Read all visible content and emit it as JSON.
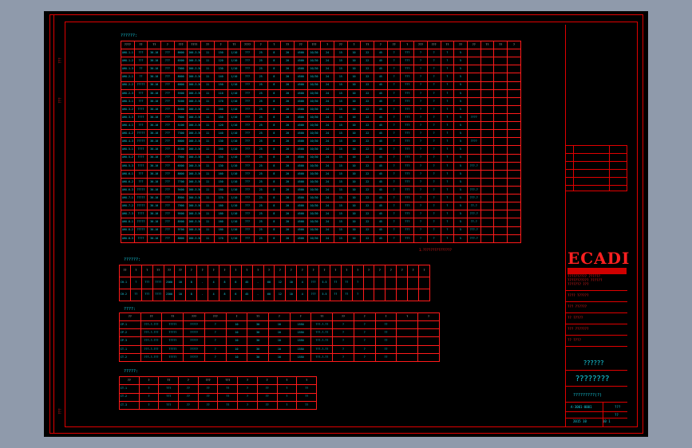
{
  "drawing": {
    "main_title": "??????:",
    "note_text": "1.???????????????",
    "section2_title": "??????:",
    "section3_title": "????:",
    "section4_title": "?????:",
    "logo": "ECADI",
    "logo_sub1": "?????????? ??????",
    "logo_sub2": "??????????? ??????",
    "logo_sub3": "??????? ???",
    "tb_field1": "???? ??????",
    "tb_field2": "??? ??????",
    "tb_field3": "?? ?????",
    "tb_field4": "??? ???????",
    "tb_field5": "?? ????",
    "tb_project": "??????",
    "tb_drawing": "????????",
    "tb_drawing_no": "?????????(?)",
    "tb_no": "A-3001-0001",
    "tb_rev1": "???",
    "tb_rev2": "??",
    "tb_date": "2015 10",
    "tb_sheet": "10 1",
    "side_label1": "???",
    "side_label2": "???",
    "side_label3": "???"
  },
  "table1": {
    "headers": [
      "????",
      "??",
      "??",
      "?",
      "???",
      "????",
      "??",
      "?",
      "??",
      "????",
      "?",
      "?",
      "??",
      "??",
      "???",
      "?",
      "??",
      "?",
      "??",
      "?",
      "??",
      "?",
      "???",
      "???",
      "??",
      "??",
      "??",
      "??",
      "??",
      "?"
    ],
    "rows": [
      [
        "AHU-1-1",
        "???",
        "30-10",
        "???",
        "8600",
        "200-3-50",
        "11",
        "150",
        "1/10",
        "???",
        "25",
        "8",
        "20",
        "4500",
        "10/30",
        "24",
        "15",
        "10",
        "22",
        "45",
        "?",
        "???",
        "?",
        "?",
        "?",
        "5",
        ""
      ],
      [
        "AHU-1-2",
        "???",
        "30-10",
        "???",
        "6500",
        "200-3-50",
        "11",
        "120",
        "1/10",
        "???",
        "25",
        "8",
        "20",
        "4500",
        "10/30",
        "24",
        "15",
        "10",
        "22",
        "45",
        "?",
        "???",
        "?",
        "?",
        "?",
        "5",
        ""
      ],
      [
        "AHU-1-3",
        "??",
        "30-10",
        "???",
        "7000",
        "200-3-50",
        "11",
        "130",
        "1/10",
        "???",
        "25",
        "8",
        "20",
        "4500",
        "10/30",
        "24",
        "15",
        "10",
        "22",
        "45",
        "?",
        "???",
        "?",
        "?",
        "?",
        "5",
        ""
      ],
      [
        "AHU-2-1",
        "??",
        "30-10",
        "???",
        "8000",
        "200-3-50",
        "11",
        "140",
        "1/10",
        "???",
        "25",
        "8",
        "20",
        "4500",
        "10/30",
        "24",
        "15",
        "10",
        "22",
        "45",
        "?",
        "???",
        "?",
        "?",
        "?",
        "5",
        ""
      ],
      [
        "AHU-2-2",
        "?????",
        "30-10",
        "???",
        "6800",
        "200-3-50",
        "11",
        "150",
        "1/10",
        "???",
        "25",
        "8",
        "20",
        "4500",
        "10/30",
        "24",
        "15",
        "10",
        "22",
        "45",
        "?",
        "???",
        "?",
        "?",
        "?",
        "5",
        ""
      ],
      [
        "AHU-2-3",
        "???",
        "30-10",
        "???",
        "5500",
        "200-3-50",
        "11",
        "110",
        "1/10",
        "???",
        "25",
        "8",
        "20",
        "4500",
        "10/30",
        "24",
        "15",
        "10",
        "22",
        "45",
        "?",
        "???",
        "?",
        "?",
        "?",
        "5",
        ""
      ],
      [
        "AHU-3-1",
        "???",
        "30-10",
        "???",
        "9200",
        "200-3-50",
        "11",
        "170",
        "1/10",
        "???",
        "25",
        "8",
        "20",
        "4500",
        "10/30",
        "24",
        "15",
        "10",
        "22",
        "45",
        "?",
        "???",
        "?",
        "?",
        "?",
        "5",
        ""
      ],
      [
        "AHU-3-2",
        "????",
        "30-10",
        "???",
        "8400",
        "200-3-50",
        "11",
        "160",
        "1/10",
        "???",
        "25",
        "8",
        "20",
        "4500",
        "10/30",
        "24",
        "15",
        "10",
        "22",
        "45",
        "?",
        "???",
        "?",
        "?",
        "?",
        "5",
        ""
      ],
      [
        "AHU-3-3",
        "????",
        "30-10",
        "???",
        "7600",
        "200-3-50",
        "11",
        "150",
        "1/10",
        "???",
        "25",
        "8",
        "20",
        "4500",
        "10/30",
        "24",
        "15",
        "10",
        "22",
        "45",
        "?",
        "???",
        "?",
        "?",
        "?",
        "5",
        "????"
      ],
      [
        "AHU-4-1",
        "???",
        "30-10",
        "???",
        "5100",
        "200-3-50",
        "11",
        "120",
        "1/10",
        "???",
        "25",
        "8",
        "20",
        "4500",
        "10/30",
        "24",
        "15",
        "10",
        "22",
        "45",
        "?",
        "???",
        "?",
        "?",
        "?",
        "5",
        ""
      ],
      [
        "AHU-4-2",
        "?????",
        "30-10",
        "???",
        "7300",
        "200-3-50",
        "11",
        "140",
        "1/10",
        "???",
        "25",
        "8",
        "20",
        "4500",
        "10/30",
        "24",
        "15",
        "10",
        "22",
        "45",
        "?",
        "???",
        "?",
        "?",
        "?",
        "5",
        ""
      ],
      [
        "AHU-4-3",
        "?????",
        "30-10",
        "???",
        "6800",
        "200-3-50",
        "11",
        "130",
        "1/10",
        "???",
        "25",
        "8",
        "20",
        "4500",
        "10/30",
        "24",
        "15",
        "10",
        "22",
        "45",
        "?",
        "???",
        "?",
        "?",
        "?",
        "5",
        "????"
      ],
      [
        "AHU-5-1",
        "????",
        "30-10",
        "???",
        "8100",
        "200-3-50",
        "11",
        "160",
        "1/10",
        "???",
        "25",
        "8",
        "20",
        "4500",
        "10/30",
        "24",
        "15",
        "10",
        "22",
        "45",
        "?",
        "???",
        "?",
        "?",
        "?",
        "5",
        ""
      ],
      [
        "AHU-5-2",
        "????",
        "30-10",
        "???",
        "7900",
        "200-3-50",
        "11",
        "150",
        "1/10",
        "???",
        "25",
        "8",
        "20",
        "4500",
        "10/30",
        "24",
        "15",
        "10",
        "22",
        "45",
        "?",
        "???",
        "?",
        "?",
        "?",
        "5",
        ""
      ],
      [
        "AHU-5-3",
        "????",
        "30-10",
        "???",
        "6500",
        "200-3-50",
        "11",
        "130",
        "1/10",
        "???",
        "25",
        "8",
        "20",
        "4500",
        "10/30",
        "24",
        "15",
        "10",
        "22",
        "45",
        "?",
        "???",
        "?",
        "?",
        "?",
        "5",
        "???-?"
      ],
      [
        "AHU-6-1",
        "???",
        "30-10",
        "???",
        "8800",
        "200-3-50",
        "11",
        "160",
        "1/10",
        "???",
        "25",
        "8",
        "20",
        "4500",
        "10/30",
        "24",
        "15",
        "10",
        "22",
        "45",
        "?",
        "???",
        "?",
        "?",
        "?",
        "5",
        ""
      ],
      [
        "AHU-6-2",
        "???",
        "30-10",
        "???",
        "7700",
        "200-3-50",
        "11",
        "150",
        "1/10",
        "???",
        "25",
        "8",
        "20",
        "4500",
        "10/30",
        "24",
        "15",
        "10",
        "22",
        "45",
        "?",
        "???",
        "?",
        "?",
        "?",
        "5",
        ""
      ],
      [
        "AHU-6-3",
        "?????",
        "30-10",
        "???",
        "9400",
        "200-3-50",
        "11",
        "180",
        "1/10",
        "???",
        "25",
        "8",
        "20",
        "4500",
        "10/30",
        "24",
        "15",
        "10",
        "22",
        "45",
        "?",
        "???",
        "?",
        "?",
        "?",
        "5",
        "???-?"
      ],
      [
        "AHU-7-1",
        "?????",
        "30-10",
        "???",
        "8900",
        "200-3-50",
        "11",
        "170",
        "1/10",
        "???",
        "25",
        "8",
        "20",
        "4500",
        "10/30",
        "24",
        "15",
        "10",
        "22",
        "45",
        "?",
        "???",
        "?",
        "?",
        "?",
        "5",
        "???-?"
      ],
      [
        "AHU-7-2",
        "?????",
        "30-10",
        "???",
        "7900",
        "200-3-50",
        "11",
        "160",
        "1/10",
        "???",
        "25",
        "8",
        "20",
        "4500",
        "10/30",
        "24",
        "15",
        "10",
        "22",
        "45",
        "?",
        "???",
        "?",
        "?",
        "?",
        "5",
        "??-?"
      ],
      [
        "AHU-7-3",
        "????",
        "30-10",
        "???",
        "9500",
        "200-3-50",
        "11",
        "180",
        "1/10",
        "???",
        "25",
        "8",
        "20",
        "4500",
        "10/30",
        "24",
        "15",
        "10",
        "22",
        "45",
        "?",
        "???",
        "?",
        "?",
        "?",
        "5",
        "???-?"
      ],
      [
        "AHU-8-1",
        "?????",
        "30-10",
        "???",
        "8500",
        "200-3-50",
        "11",
        "160",
        "1/10",
        "???",
        "25",
        "8",
        "20",
        "4500",
        "10/30",
        "24",
        "15",
        "10",
        "22",
        "45",
        "?",
        "???",
        "?",
        "?",
        "?",
        "5",
        "??-?"
      ],
      [
        "AHU-8-2",
        "?????",
        "30-10",
        "???",
        "9700",
        "200-3-50",
        "11",
        "180",
        "1/10",
        "???",
        "25",
        "8",
        "20",
        "4500",
        "10/30",
        "24",
        "15",
        "10",
        "22",
        "45",
        "?",
        "???",
        "?",
        "?",
        "?",
        "5",
        "???-?"
      ],
      [
        "AHU-8-3",
        "????",
        "30-10",
        "???",
        "8800",
        "200-3-50",
        "11",
        "170",
        "1/10",
        "???",
        "25",
        "8",
        "20",
        "4500",
        "10/30",
        "24",
        "15",
        "10",
        "22",
        "45",
        "?",
        "???",
        "?",
        "?",
        "?",
        "5",
        "???-?"
      ]
    ]
  },
  "table2": {
    "headers": [
      "??",
      "?",
      "?",
      "??",
      "??",
      "??",
      "?",
      "?",
      "?",
      "?",
      "?",
      "?",
      "?",
      "?",
      "?",
      "?",
      "?",
      "?",
      "?",
      "?",
      "?",
      "?",
      "?",
      "?",
      "?",
      "?",
      "?",
      "?"
    ],
    "rows": [
      [
        "CH-1",
        "?",
        "???",
        "????",
        "2560",
        "10",
        "8",
        "-",
        "4",
        "8",
        "6",
        "45",
        "-",
        "60",
        "12",
        "10",
        "4",
        "???",
        "5.5",
        "??",
        "??",
        "?"
      ],
      [
        "CH-2",
        "??",
        "???",
        "????",
        "2300",
        "10",
        "8",
        "-",
        "4",
        "8",
        "6",
        "45",
        "-",
        "60",
        "12",
        "10",
        "4",
        "???",
        "5.5",
        "??",
        "??",
        "?"
      ]
    ]
  },
  "table3": {
    "headers": [
      "??",
      "??",
      "??",
      "???",
      "???",
      "?",
      "??",
      "?",
      "?",
      "??",
      "??",
      "?",
      "?",
      "?",
      "?"
    ],
    "rows": [
      [
        "CP-1",
        "???-?-???",
        "?????",
        "?????",
        "?",
        "10",
        "30",
        "10",
        "1550",
        "???-?-??",
        "?",
        "?",
        "??"
      ],
      [
        "CP-2",
        "???-?-???",
        "?????",
        "?????",
        "?",
        "10",
        "30",
        "10",
        "1550",
        "???-?-??",
        "?",
        "?",
        "??"
      ],
      [
        "CP-3",
        "???-?-???",
        "?????",
        "?????",
        "?",
        "10",
        "30",
        "10",
        "1550",
        "???-?-??",
        "?",
        "?",
        "??"
      ],
      [
        "CT-1",
        "???-?-???",
        "?????",
        "?????",
        "?",
        "10",
        "30",
        "10",
        "1550",
        "???-?-??",
        "?",
        "?",
        "??"
      ],
      [
        "CT-2",
        "???-?-???",
        "?????",
        "?????",
        "?",
        "10",
        "30",
        "10",
        "1550",
        "???-?-??",
        "?",
        "?",
        "??"
      ]
    ]
  },
  "table4": {
    "headers": [
      "??",
      "?",
      "??",
      "?",
      "???",
      "???",
      "?",
      "?",
      "?",
      "?"
    ],
    "rows": [
      [
        "CT-1",
        "?",
        "???",
        "??",
        "??",
        "??",
        "?",
        "??",
        "?",
        "??"
      ],
      [
        "CT-2",
        "?",
        "???",
        "??",
        "??",
        "??",
        "?",
        "??",
        "?",
        "??"
      ],
      [
        "CT-3",
        "?",
        "???",
        "??",
        "??",
        "??",
        "?",
        "??",
        "?",
        "??"
      ]
    ]
  }
}
